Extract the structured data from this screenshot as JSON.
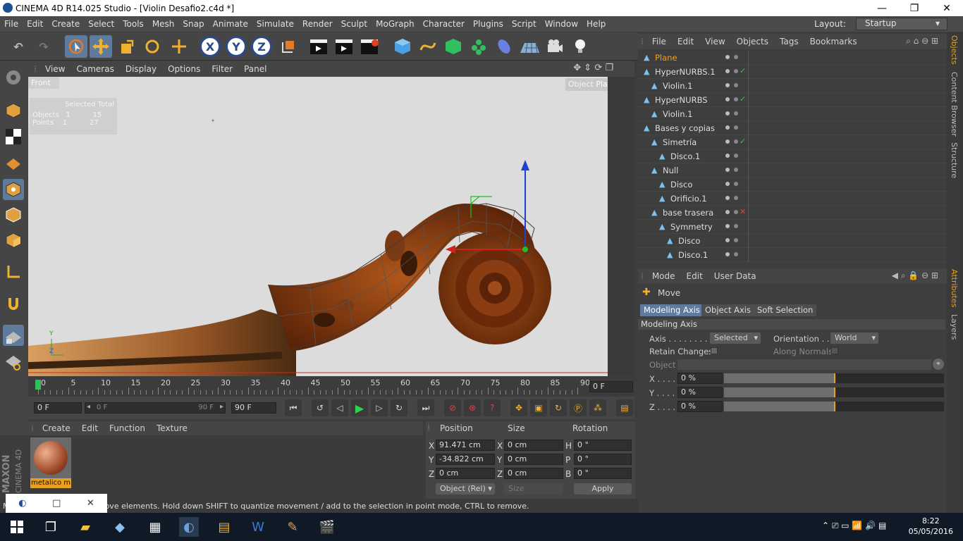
{
  "window": {
    "title": "CINEMA 4D R14.025 Studio - [Violin Desafio2.c4d *]",
    "minimize": "—",
    "maximize": "❐",
    "close": "✕"
  },
  "menubar": {
    "items": [
      "File",
      "Edit",
      "Create",
      "Select",
      "Tools",
      "Mesh",
      "Snap",
      "Animate",
      "Simulate",
      "Render",
      "Sculpt",
      "MoGraph",
      "Character",
      "Plugins",
      "Script",
      "Window",
      "Help"
    ],
    "layout_label": "Layout:",
    "layout_value": "Startup"
  },
  "toolbar": {
    "x_label": "X",
    "y_label": "Y",
    "z_label": "Z"
  },
  "viewport": {
    "menu": [
      "View",
      "Cameras",
      "Display",
      "Options",
      "Filter",
      "Panel"
    ],
    "view_name": "Front",
    "object_label": "Object",
    "object_value": "Plane",
    "stats_header": "Selected Total",
    "stats_objects": "Objects   1          15",
    "stats_points": "Points    1          27",
    "axis_y": "Y",
    "axis_z": "Z"
  },
  "timeline": {
    "ticks": [
      "0",
      "5",
      "10",
      "15",
      "20",
      "25",
      "30",
      "35",
      "40",
      "45",
      "50",
      "55",
      "60",
      "65",
      "70",
      "75",
      "80",
      "85",
      "90"
    ],
    "current_frame": "0 F",
    "start_frame": "0 F",
    "range_start": "0 F",
    "range_end": "90 F",
    "end_frame": "90 F"
  },
  "material_manager": {
    "menu": [
      "Create",
      "Edit",
      "Function",
      "Texture"
    ],
    "material_name": "metalico m",
    "brand_maxon": "MAXON",
    "brand_c4d": "CINEMA 4D"
  },
  "coordinates": {
    "headers": [
      "Position",
      "Size",
      "Rotation"
    ],
    "rows": [
      {
        "axis": "X",
        "pos": "91.471 cm",
        "size_axis": "X",
        "size": "0 cm",
        "rot_axis": "H",
        "rot": "0 °"
      },
      {
        "axis": "Y",
        "pos": "-34.822 cm",
        "size_axis": "Y",
        "size": "0 cm",
        "rot_axis": "P",
        "rot": "0 °"
      },
      {
        "axis": "Z",
        "pos": "0 cm",
        "size_axis": "Z",
        "size": "0 cm",
        "rot_axis": "B",
        "rot": "0 °"
      }
    ],
    "mode": "Object (Rel)",
    "size_mode": "Size",
    "apply": "Apply"
  },
  "status_text": "Move: Click and drag to move elements. Hold down SHIFT to quantize movement / add to the selection in point mode, CTRL to remove.",
  "object_manager": {
    "menu": [
      "File",
      "Edit",
      "View",
      "Objects",
      "Tags",
      "Bookmarks"
    ],
    "objects": [
      {
        "name": "Plane",
        "indent": 0,
        "color": "#f0a020",
        "check": ""
      },
      {
        "name": "HyperNURBS.1",
        "indent": 0,
        "color": "#dddddd",
        "check": "✓"
      },
      {
        "name": "Violin.1",
        "indent": 1,
        "color": "#dddddd",
        "check": ""
      },
      {
        "name": "HyperNURBS",
        "indent": 0,
        "color": "#dddddd",
        "check": "✓"
      },
      {
        "name": "Violin.1",
        "indent": 1,
        "color": "#dddddd",
        "check": ""
      },
      {
        "name": "Bases y copias",
        "indent": 0,
        "color": "#dddddd",
        "check": ""
      },
      {
        "name": "Simetría",
        "indent": 1,
        "color": "#dddddd",
        "check": "✓"
      },
      {
        "name": "Disco.1",
        "indent": 2,
        "color": "#dddddd",
        "check": ""
      },
      {
        "name": "Null",
        "indent": 1,
        "color": "#dddddd",
        "check": ""
      },
      {
        "name": "Disco",
        "indent": 2,
        "color": "#dddddd",
        "check": ""
      },
      {
        "name": "Orificio.1",
        "indent": 2,
        "color": "#dddddd",
        "check": ""
      },
      {
        "name": "base trasera",
        "indent": 1,
        "color": "#dddddd",
        "check": "✕"
      },
      {
        "name": "Symmetry",
        "indent": 2,
        "color": "#dddddd",
        "check": ""
      },
      {
        "name": "Disco",
        "indent": 3,
        "color": "#dddddd",
        "check": ""
      },
      {
        "name": "Disco.1",
        "indent": 3,
        "color": "#dddddd",
        "check": ""
      }
    ]
  },
  "attributes": {
    "menu": [
      "Mode",
      "Edit",
      "User Data"
    ],
    "tool_name": "Move",
    "tabs": [
      "Modeling Axis",
      "Object Axis",
      "Soft Selection"
    ],
    "section": "Modeling Axis",
    "axis_label": "Axis . . . . . . . . .",
    "axis_value": "Selected",
    "orientation_label": "Orientation . .",
    "orientation_value": "World",
    "retain_label": "Retain Changes",
    "along_label": "Along Normals",
    "object_label": "Object",
    "x_label": "X . . . .",
    "x_value": "0 %",
    "y_label": "Y . . . .",
    "y_value": "0 %",
    "z_label": "Z . . . .",
    "z_value": "0 %",
    "bar_level": 0.5
  },
  "side_tabs": [
    "Objects",
    "Content Browser",
    "Structure",
    "Attributes",
    "Layers"
  ],
  "taskbar": {
    "time": "8:22",
    "date": "05/05/2016"
  }
}
